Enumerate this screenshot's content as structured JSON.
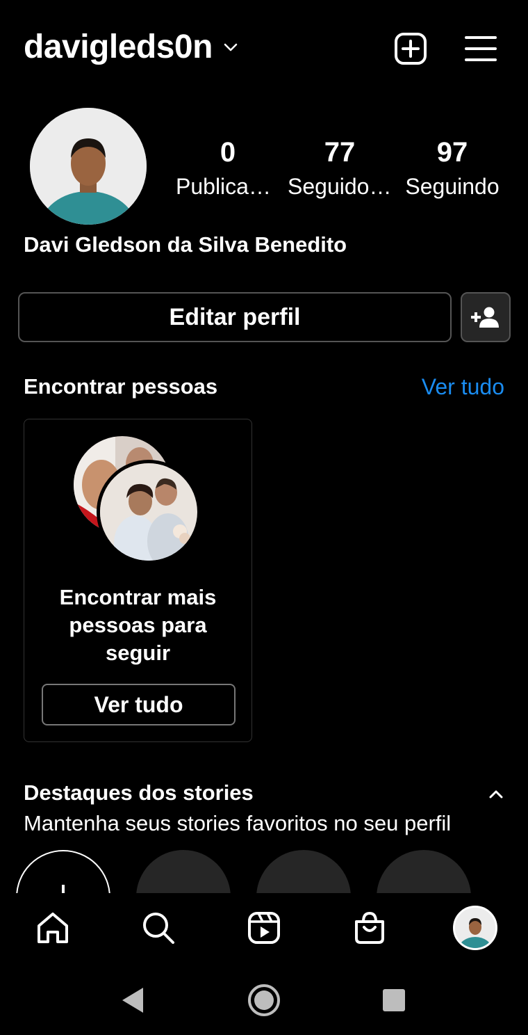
{
  "header": {
    "username": "davigleds0n",
    "new_post_icon": "plus-square-icon",
    "menu_icon": "hamburger-menu-icon"
  },
  "profile": {
    "full_name": "Davi Gledson da Silva Benedito",
    "stats": [
      {
        "value": "0",
        "label": "Publicações"
      },
      {
        "value": "77",
        "label": "Seguidores"
      },
      {
        "value": "97",
        "label": "Seguindo"
      }
    ]
  },
  "actions": {
    "edit_profile": "Editar perfil",
    "discover_icon": "add-person-icon"
  },
  "discover": {
    "title": "Encontrar pessoas",
    "see_all_link": "Ver tudo",
    "card_text": "Encontrar mais pessoas para seguir",
    "card_button": "Ver tudo"
  },
  "highlights": {
    "title": "Destaques dos stories",
    "subtitle": "Mantenha seus stories favoritos no seu perfil"
  },
  "tabs": [
    "home-icon",
    "search-icon",
    "reels-icon",
    "shop-icon",
    "profile-avatar"
  ],
  "system_nav": [
    "back-icon",
    "home-icon",
    "recents-icon"
  ],
  "colors": {
    "background": "#000000",
    "link": "#1a8cf0",
    "border": "#555555",
    "placeholder_circle": "#262626"
  }
}
